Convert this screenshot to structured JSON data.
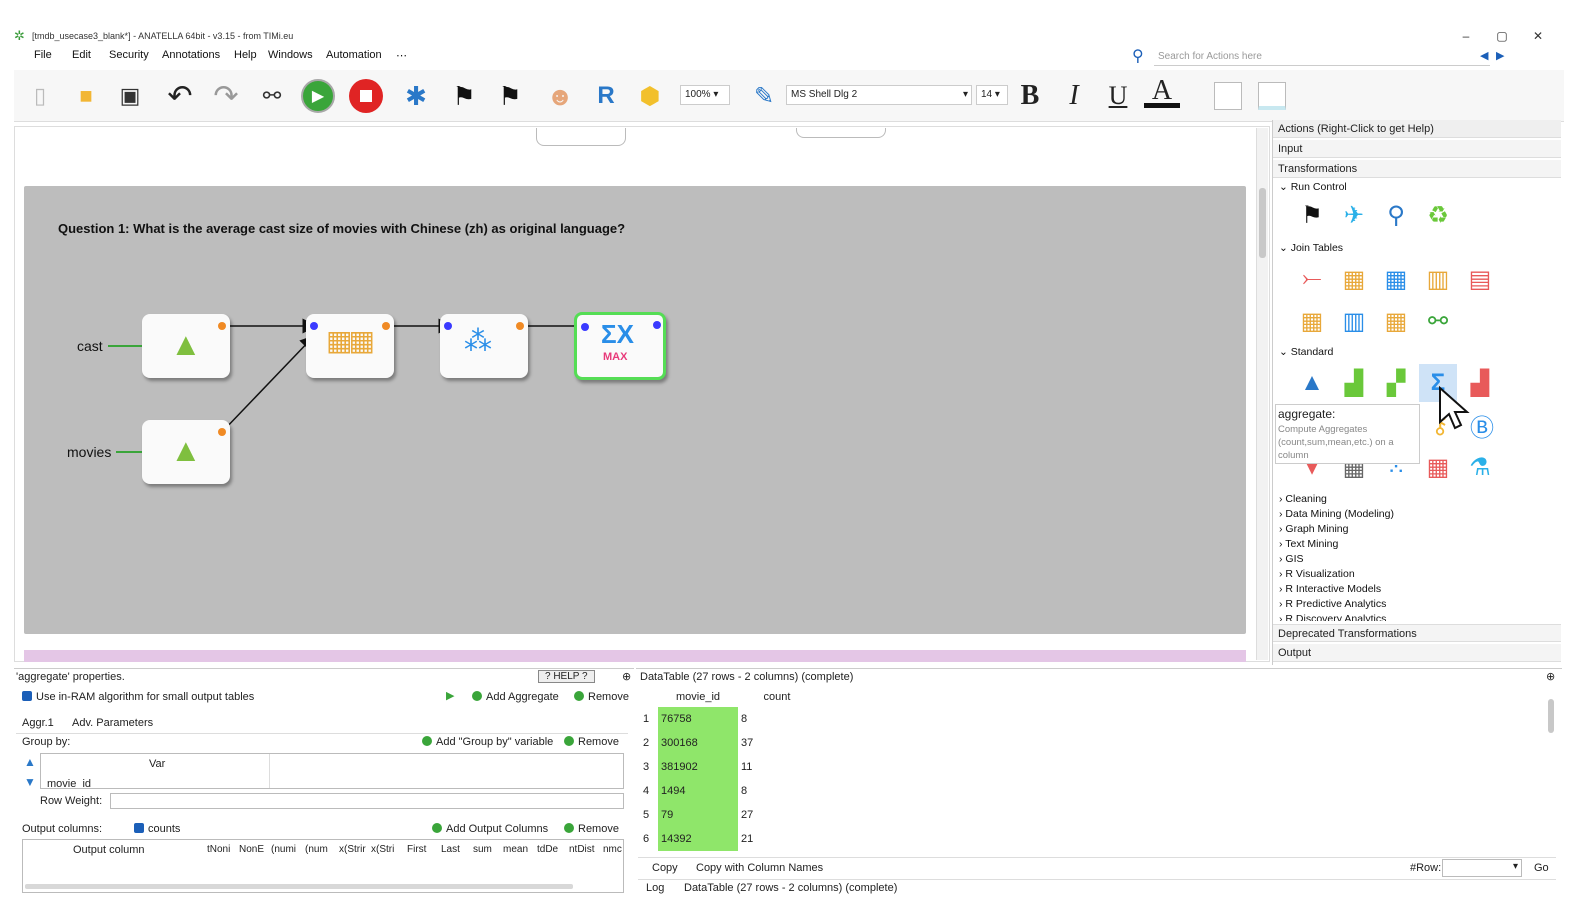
{
  "window": {
    "title": "[tmdb_usecase3_blank*] - ANATELLA 64bit - v3.15 - from TIMi.eu",
    "controls": [
      "–",
      "▢",
      "✕"
    ]
  },
  "menu": {
    "items": [
      "File",
      "Edit",
      "Security",
      "Annotations",
      "Help",
      "Windows",
      "Automation",
      "⋯"
    ],
    "search_placeholder": "Search for Actions here"
  },
  "toolbar": {
    "zoom": "100%",
    "font_name": "MS Shell Dlg 2",
    "font_size": "14",
    "bold": "B",
    "italic": "I",
    "underline": "U",
    "font_color": "A"
  },
  "canvas": {
    "question": "Question 1: What is the average cast size of movies with Chinese (zh) as original language?",
    "inputs": [
      "cast",
      "movies"
    ],
    "node_icons": [
      "read-input-icon",
      "read-input-icon",
      "join-icon",
      "sort-icon",
      "aggregate-icon"
    ],
    "aggregate_text": "MAX"
  },
  "actions": {
    "header": "Actions (Right-Click to get Help)",
    "input": "Input",
    "transformations": "Transformations",
    "sections": {
      "run_control": "Run Control",
      "join_tables": "Join Tables",
      "standard": "Standard"
    },
    "tooltip": {
      "title": "aggregate:",
      "description": "Compute Aggregates (count,sum,mean,etc.) on a column"
    },
    "categories": [
      "Cleaning",
      "Data Mining (Modeling)",
      "Graph Mining",
      "Text Mining",
      "GIS",
      "R Visualization",
      "R Interactive Models",
      "R Predictive Analytics",
      "R Discovery Analytics"
    ],
    "deprecated": "Deprecated Transformations",
    "output": "Output"
  },
  "properties": {
    "title": "'aggregate' properties.",
    "help": "? HELP ?",
    "use_ram": "Use in-RAM algorithm for small output tables",
    "add_aggregate": "Add Aggregate",
    "remove": "Remove",
    "tabs": [
      "Aggr.1",
      "Adv. Parameters"
    ],
    "group_by": "Group by:",
    "add_group_by": "Add \"Group by\" variable",
    "var_header": "Var",
    "var_value": "movie_id",
    "row_weight": "Row Weight:",
    "output_columns": "Output columns:",
    "counts": "counts",
    "add_output_columns": "Add Output Columns",
    "output_headers": [
      "Output column",
      "tNoni",
      "NonE",
      "(numi",
      "(num",
      "x(Strir",
      "x(Stri",
      "First",
      "Last",
      "sum",
      "mean",
      "tdDe",
      "ntDist",
      "nmc"
    ]
  },
  "datatable": {
    "title": "DataTable (27 rows - 2 columns) (complete)",
    "columns": [
      "movie_id",
      "count"
    ],
    "rows": [
      {
        "n": "1",
        "movie_id": "76758",
        "count": "8"
      },
      {
        "n": "2",
        "movie_id": "300168",
        "count": "37"
      },
      {
        "n": "3",
        "movie_id": "381902",
        "count": "11"
      },
      {
        "n": "4",
        "movie_id": "1494",
        "count": "8"
      },
      {
        "n": "5",
        "movie_id": "79",
        "count": "27"
      },
      {
        "n": "6",
        "movie_id": "14392",
        "count": "21"
      }
    ],
    "copy": "Copy",
    "copy_with_names": "Copy with Column Names",
    "row_label": "#Row:",
    "go": "Go",
    "log_tab": "Log",
    "status_tab": "DataTable (27 rows - 2 columns) (complete)"
  }
}
